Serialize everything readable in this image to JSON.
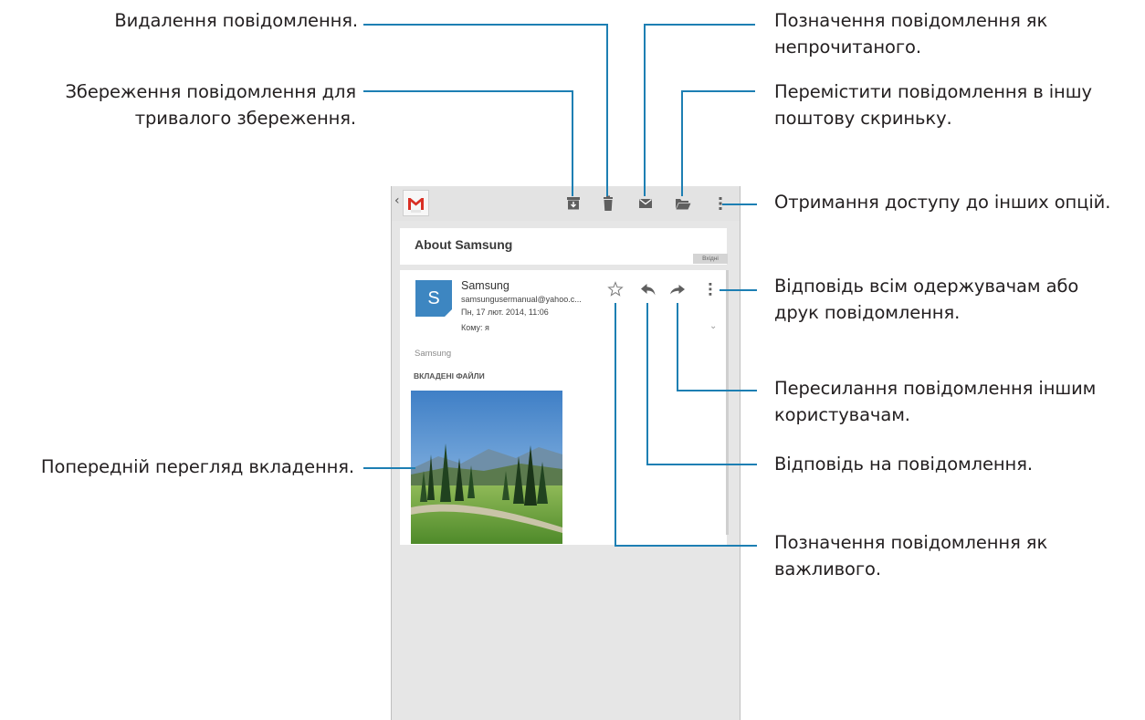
{
  "callouts": {
    "delete": "Видалення повідомлення.",
    "archive_line1": "Збереження повідомлення для",
    "archive_line2": "тривалого збереження.",
    "mark_unread_line1": "Позначення повідомлення як",
    "mark_unread_line2": "непрочитаного.",
    "move_line1": "Перемістити повідомлення в іншу",
    "move_line2": "поштову скриньку.",
    "more_options": "Отримання доступу до інших опцій.",
    "reply_all_line1": "Відповідь всім одержувачам або",
    "reply_all_line2": "друк повідомлення.",
    "forward_line1": "Пересилання повідомлення іншим",
    "forward_line2": "користувачам.",
    "reply": "Відповідь на повідомлення.",
    "preview": "Попередній перегляд вкладення.",
    "star_line1": "Позначення повідомлення як",
    "star_line2": "важливого."
  },
  "toolbar": {
    "back_glyph": "‹",
    "icons": [
      "gmail-logo-icon",
      "archive-icon",
      "trash-icon",
      "mail-unread-icon",
      "folder-move-icon",
      "overflow-menu-icon"
    ]
  },
  "email": {
    "subject": "About Samsung",
    "label": "Вхідні",
    "avatar_letter": "S",
    "sender": "Samsung",
    "address": "samsungusermanual@yahoo.c...",
    "date": "Пн, 17 лют. 2014, 11:06",
    "to": "Кому: я",
    "body": "Samsung",
    "attachments_heading": "ВКЛАДЕНІ ФАЙЛИ"
  },
  "colors": {
    "accent": "#3d86c1",
    "leader_line": "#1d7fb3",
    "toolbar_bg": "#e3e3e3",
    "screen_bg": "#e6e6e6",
    "icon_gray": "#5f5f5f"
  }
}
